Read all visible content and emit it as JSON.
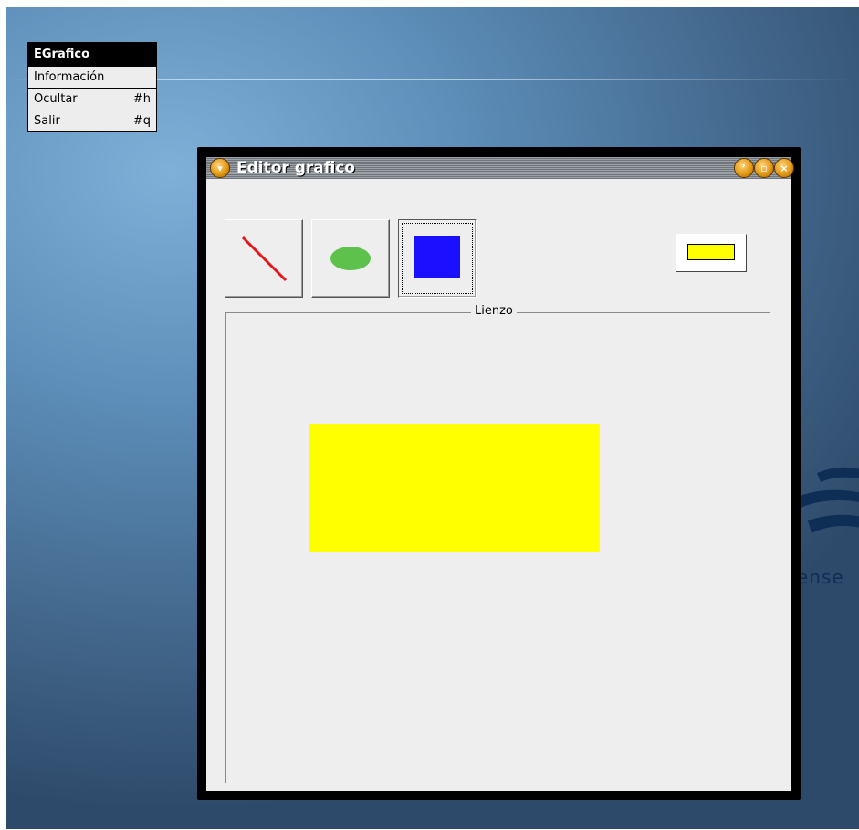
{
  "desktop": {
    "logo_text": "ense"
  },
  "app_menu": {
    "title": "EGrafico",
    "items": [
      {
        "label": "Información",
        "shortcut": ""
      },
      {
        "label": "Ocultar",
        "shortcut": "#h"
      },
      {
        "label": "Salir",
        "shortcut": "#q"
      }
    ]
  },
  "window": {
    "title": "Editor grafico",
    "controls": {
      "menu_icon": "chevron-down-icon",
      "shade_icon": "shade-icon",
      "maximize_icon": "maximize-icon",
      "close_icon": "close-icon"
    },
    "tools": [
      {
        "name": "line",
        "icon": "line-tool-icon",
        "color": "#e8141c",
        "selected": false
      },
      {
        "name": "ellipse",
        "icon": "ellipse-tool-icon",
        "color": "#5cc24c",
        "selected": false
      },
      {
        "name": "rectangle",
        "icon": "rectangle-tool-icon",
        "color": "#1a10ff",
        "selected": true
      }
    ],
    "current_color": "#ffff00",
    "canvas": {
      "label": "Lienzo",
      "shapes": [
        {
          "type": "rectangle",
          "fill": "#ffff00"
        }
      ]
    }
  }
}
